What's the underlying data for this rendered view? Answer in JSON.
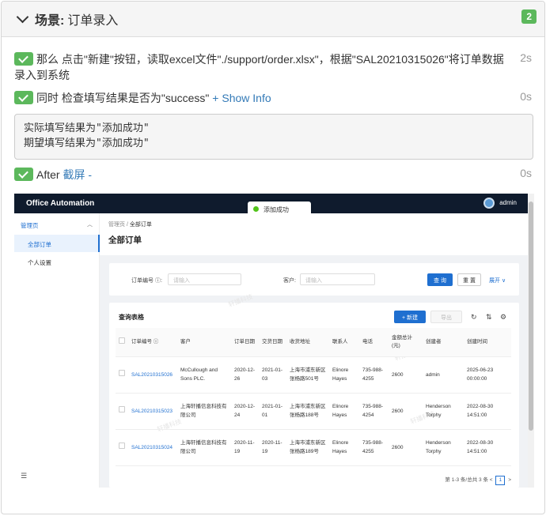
{
  "header": {
    "scene_key": "场景:",
    "scene_value": "订单录入",
    "badge": "2"
  },
  "steps": [
    {
      "text": "那么 点击\"新建\"按钮，读取excel文件\"./support/order.xlsx\"，根据\"SAL20210315026\"将订单数据录入到系统",
      "duration": "2s"
    },
    {
      "text": "同时 检查填写结果是否为\"success\"",
      "link": "+ Show Info",
      "duration": "0s"
    },
    {
      "text": "After",
      "link": "截屏 -",
      "duration": "0s"
    }
  ],
  "info": {
    "line1": "实际填写结果为\"添加成功\"",
    "line2": "期望填写结果为\"添加成功\""
  },
  "screenshot": {
    "app_title": "Office Automation",
    "user": "admin",
    "toast": "添加成功",
    "sidebar": {
      "group": "管理页",
      "items": [
        "全部订单",
        "个人设置"
      ]
    },
    "breadcrumb": {
      "home": "管理页",
      "sep": "/",
      "current": "全部订单"
    },
    "page_title": "全部订单",
    "filter": {
      "order_label": "订单编号 ⓘ:",
      "order_placeholder": "请输入",
      "customer_label": "客户:",
      "customer_placeholder": "请输入",
      "search": "查 询",
      "reset": "重 置",
      "expand": "展开 ∨"
    },
    "table_title": "查询表格",
    "new_btn": "+ 新建",
    "export_btn": "导出",
    "watermark": "轩播科技",
    "columns": [
      "订单编号 ⓘ",
      "客户",
      "订单日期",
      "交货日期",
      "收货地址",
      "联系人",
      "电话",
      "金额总计(元)",
      "创建者",
      "创建时间"
    ],
    "rows": [
      [
        "SAL20210315026",
        "McCullough and Sons PLC.",
        "2020-12-26",
        "2021-01-03",
        "上海市浦东新区张杨路501号",
        "Elinore Hayes",
        "735-988-4255",
        "2600",
        "admin",
        "2025-06-23 00:00:00"
      ],
      [
        "SAL20210315023",
        "上海轩播信息科技有限公司",
        "2020-12-24",
        "2021-01-01",
        "上海市浦东新区张杨路188号",
        "Elinore Hayes",
        "735-988-4254",
        "2600",
        "Henderson Torphy",
        "2022-08-30 14:51:00"
      ],
      [
        "SAL20210315024",
        "上海轩播信息科技有限公司",
        "2020-11-19",
        "2020-11-19",
        "上海市浦东新区张杨路189号",
        "Elinore Hayes",
        "735-988-4255",
        "2600",
        "Henderson Torphy",
        "2022-08-30 14:51:00"
      ]
    ],
    "pagination": {
      "summary": "第 1-3 条/总共 3 条",
      "prev": "<",
      "page": "1",
      "next": ">"
    }
  }
}
